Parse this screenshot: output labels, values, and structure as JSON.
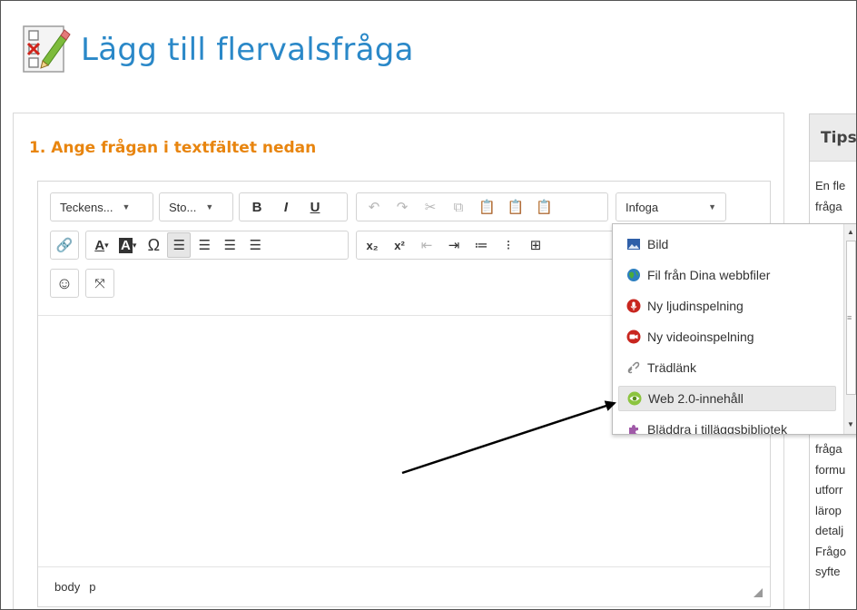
{
  "header": {
    "title": "Lägg till flervalsfråga",
    "icon": "multiple-choice-icon"
  },
  "section": {
    "heading": "1. Ange frågan i textfältet nedan"
  },
  "editor": {
    "toolbar": {
      "font_family": "Teckens...",
      "font_size": "Sto...",
      "bold": "B",
      "italic": "I",
      "underline": "U",
      "insert": "Infoga",
      "text_color": "A",
      "bg_color": "A",
      "special_char": "Ω",
      "subscript": "x₂",
      "superscript": "x²"
    },
    "statusbar": {
      "path": [
        "body",
        "p"
      ]
    }
  },
  "insert_menu": {
    "items": [
      {
        "label": "Bild",
        "icon": "image-icon"
      },
      {
        "label": "Fil från Dina webbfiler",
        "icon": "globe-icon"
      },
      {
        "label": "Ny ljudinspelning",
        "icon": "microphone-icon"
      },
      {
        "label": "Ny videoinspelning",
        "icon": "video-camera-icon"
      },
      {
        "label": "Trädlänk",
        "icon": "link-icon"
      },
      {
        "label": "Web 2.0-innehåll",
        "icon": "eye-icon"
      },
      {
        "label": "Bläddra i tilläggsbibliotek",
        "icon": "puzzle-icon"
      }
    ],
    "highlighted_index": 5
  },
  "tips": {
    "title": "Tips",
    "lines_top": [
      "En fle",
      "fråga"
    ],
    "lines_bottom": [
      "fråga",
      "formu",
      "utforr",
      "lärop",
      "detalj",
      "Frågo",
      "syfte"
    ]
  },
  "colors": {
    "title_blue": "#2a88c8",
    "heading_orange": "#e8850f",
    "arrow": "#000000"
  }
}
